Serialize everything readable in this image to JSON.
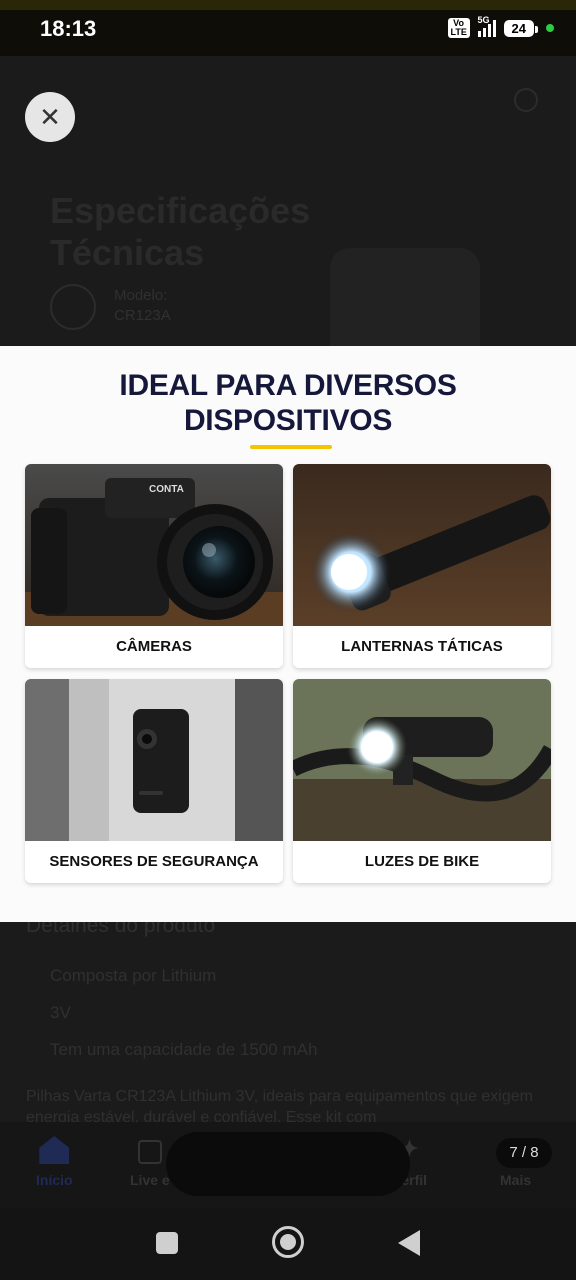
{
  "status_bar": {
    "time": "18:13",
    "volte": "Vo LTE",
    "network": "5G",
    "battery": "24"
  },
  "background_page": {
    "title": "Especificações Técnicas",
    "model_label": "Modelo:",
    "model_value": "CR123A",
    "section_title": "Detalhes do produto",
    "bullets": [
      "Composta por Lithium",
      "3V",
      "Tem uma capacidade de 1500 mAh"
    ],
    "description": "Pilhas Varta CR123A Lithium 3V, ideais para equipamentos que exigem energia estável, durável e confiável. Esse kit com"
  },
  "bottom_nav": {
    "home": "Início",
    "live": "Live e",
    "profile": "Perfil",
    "more": "Mais"
  },
  "viewer": {
    "page_counter": "7 / 8",
    "close_icon": "close-icon"
  },
  "panel": {
    "title_line1": "IDEAL PARA DIVERSOS",
    "title_line2": "DISPOSITIVOS",
    "accent_color": "#f5c400",
    "camera_brand": "CONTA",
    "cards": [
      {
        "label": "CÂMERAS"
      },
      {
        "label": "LANTERNAS TÁTICAS"
      },
      {
        "label": "SENSORES DE SEGURANÇA"
      },
      {
        "label": "LUZES DE BIKE"
      }
    ]
  }
}
